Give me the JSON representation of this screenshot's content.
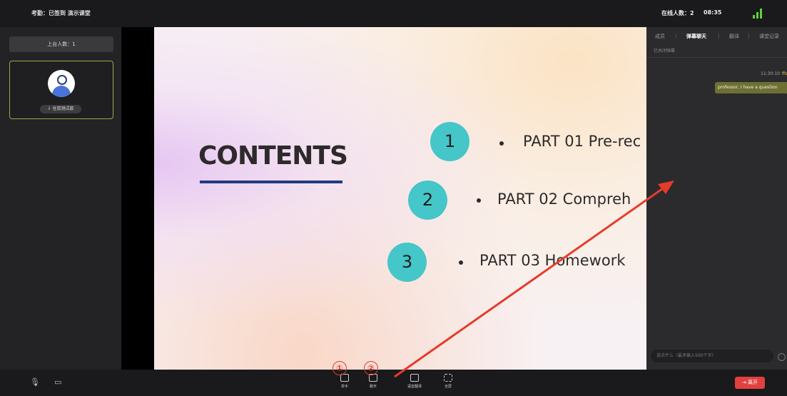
{
  "topbar": {
    "attendance": "考勤：已签到  演示课堂",
    "online_label": "在线人数：2",
    "time": "08:35",
    "signal_color": "#5fd13a"
  },
  "left_panel": {
    "stage_count": "上台人数：1",
    "mic_tag": "⇩ 仓鼠测试款"
  },
  "slide": {
    "title": "CONTENTS",
    "items": [
      {
        "num": "1",
        "text": "PART 01 Pre-rec"
      },
      {
        "num": "2",
        "text": "PART 02 Compreh"
      },
      {
        "num": "3",
        "text": "PART 03 Homework"
      }
    ],
    "accent_color": "#45c6c8",
    "underline_color": "#223a83"
  },
  "chat_panel": {
    "tabs": [
      "成员",
      "弹幕聊天",
      "翻译",
      "课堂记录"
    ],
    "active_tab": "弹幕聊天",
    "subtitle": "已关闭弹幕",
    "message": {
      "time": "11:30:10",
      "sender": "ffsf",
      "text": "professor, I have a question"
    },
    "input_placeholder": "说点什么（最多输入500个字）"
  },
  "bottom_bar": {
    "tools": [
      {
        "label": "举手",
        "icon": "raise-hand-icon"
      },
      {
        "label": "聊天",
        "icon": "chat-icon"
      },
      {
        "label": "语音翻译",
        "icon": "voice-translate-icon"
      },
      {
        "label": "全屏",
        "icon": "fullscreen-icon"
      }
    ],
    "exit_label": "⇥ 离开",
    "exit_color": "#e1403e"
  },
  "annotations": {
    "marker1": "①",
    "marker2": "②",
    "color": "#e53b2c"
  }
}
